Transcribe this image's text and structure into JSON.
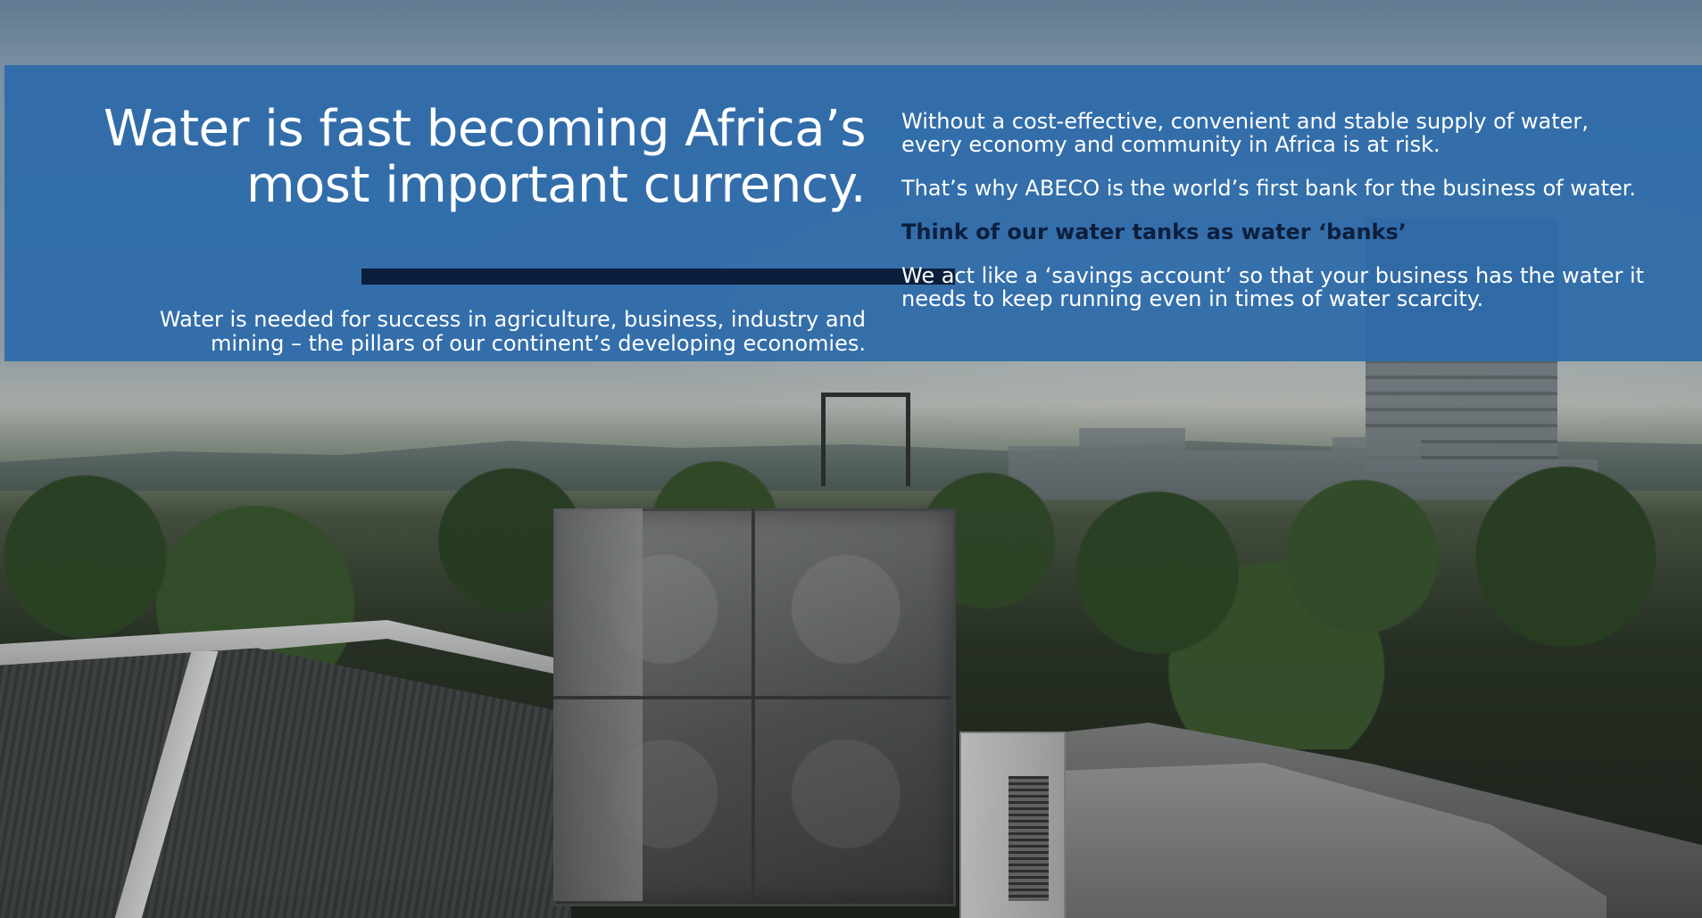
{
  "hero": {
    "headline_line1": "Water is fast becoming Africa’s",
    "headline_line2": "most important currency.",
    "intro_line1": "Water is needed for success in agriculture, business, industry and",
    "intro_line2": "mining – the pillars of our continent’s developing economies."
  },
  "details": {
    "para1_line1": "Without a cost-effective, convenient and stable supply of water,",
    "para1_line2": "every economy and community in Africa is at risk.",
    "para2": "That’s why ABECO is the world’s first bank for the business of water.",
    "para3": "Think of our water tanks as water ‘banks’",
    "para4_line1": "We act like a ‘savings account’ so that your business has the water it",
    "para4_line2": "needs to keep running even in times of water scarcity."
  },
  "colors": {
    "banner": "#2c6aaa",
    "divider": "#0b1f3d",
    "emphasis_text": "#0b1f3d"
  }
}
